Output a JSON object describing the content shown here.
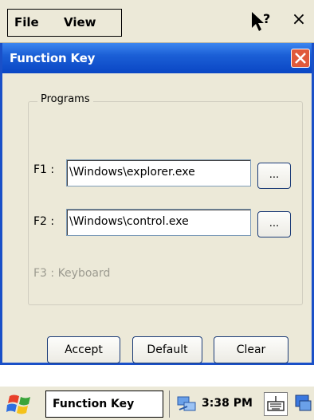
{
  "menubar": {
    "file_label": "File",
    "view_label": "View",
    "close_glyph": "×",
    "help_icon": "help-arrow-icon"
  },
  "dialog": {
    "title": "Function Key",
    "group_label": "Programs",
    "rows": [
      {
        "label": "F1 :",
        "value": "\\Windows\\explorer.exe",
        "browse": "..."
      },
      {
        "label": "F2 :",
        "value": "\\Windows\\control.exe",
        "browse": "..."
      }
    ],
    "f3_label": "F3 : Keyboard",
    "buttons": {
      "accept": "Accept",
      "default": "Default",
      "clear": "Clear"
    }
  },
  "taskbar": {
    "task_label": "Function Key",
    "clock": "3:38 PM"
  },
  "colors": {
    "titlebar": "#1b5fd6",
    "close_red": "#e05a3b",
    "dialog_bg": "#ece9d8",
    "disabled_text": "#9c9b90"
  }
}
